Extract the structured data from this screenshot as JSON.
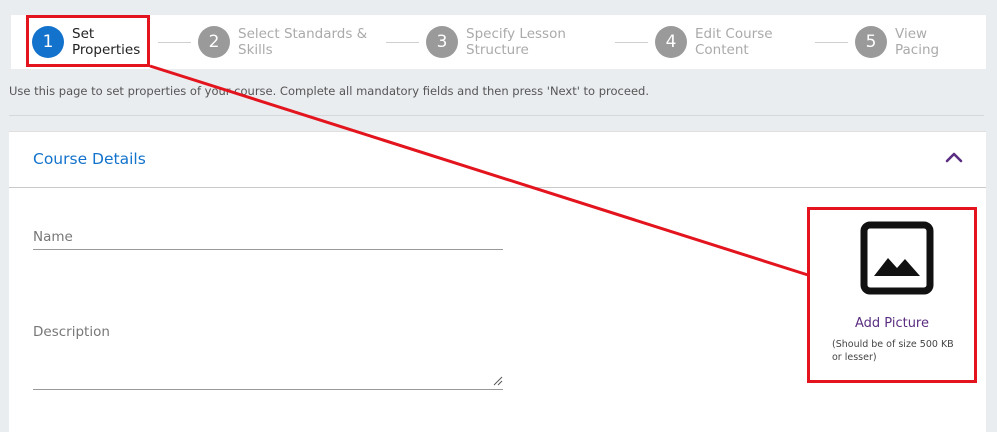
{
  "stepper": {
    "steps": [
      {
        "number": "1",
        "label": "Set Properties",
        "active": true
      },
      {
        "number": "2",
        "label": "Select Standards & Skills",
        "active": false
      },
      {
        "number": "3",
        "label": "Specify Lesson Structure",
        "active": false
      },
      {
        "number": "4",
        "label": "Edit Course Content",
        "active": false
      },
      {
        "number": "5",
        "label": "View Pacing",
        "active": false
      }
    ]
  },
  "hint": "Use this page to set properties of your course. Complete all mandatory fields and then press 'Next' to proceed.",
  "card": {
    "title": "Course Details",
    "fields": {
      "name_label": "Name",
      "description_label": "Description"
    },
    "picture": {
      "label": "Add Picture",
      "size_note": "(Should be of size 500 KB or lesser)"
    }
  },
  "colors": {
    "accent": "#1373cc",
    "highlight": "#e3141d",
    "add_picture": "#5a2d82",
    "inactive_step": "#9a9a9a"
  },
  "icons": {
    "collapse": "chevron-up-icon",
    "picture": "image-icon"
  }
}
